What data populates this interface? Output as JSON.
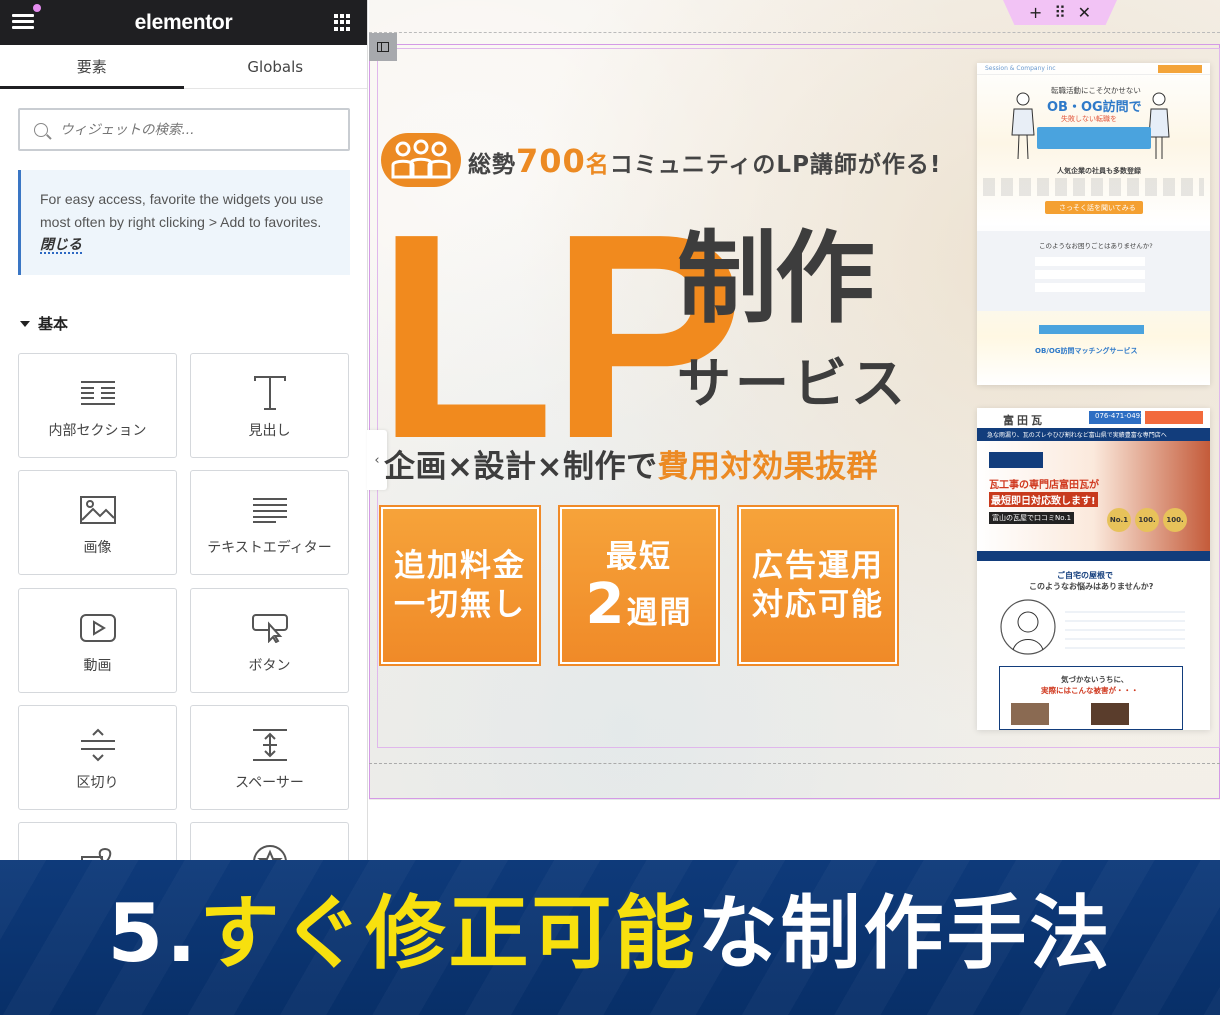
{
  "panel": {
    "logo": "elementor",
    "tabs": [
      "要素",
      "Globals"
    ],
    "search_placeholder": "ウィジェットの検索...",
    "notice_text": "For easy access, favorite the widgets you use most often by right clicking > Add to favorites.",
    "notice_link": "閉じる",
    "category": "基本",
    "widgets": [
      {
        "label": "内部セクション",
        "icon": "inner-section-icon"
      },
      {
        "label": "見出し",
        "icon": "heading-icon"
      },
      {
        "label": "画像",
        "icon": "image-icon"
      },
      {
        "label": "テキストエディター",
        "icon": "text-editor-icon"
      },
      {
        "label": "動画",
        "icon": "video-icon"
      },
      {
        "label": "ボタン",
        "icon": "button-icon"
      },
      {
        "label": "区切り",
        "icon": "divider-icon"
      },
      {
        "label": "スペーサー",
        "icon": "spacer-icon"
      }
    ]
  },
  "canvas": {
    "section_handle": [
      "+",
      "⠿",
      "✕"
    ],
    "tagline_pre": "総勢",
    "tagline_num": "700",
    "tagline_post_accent": "名",
    "tagline_post": "コミュニティのLP講師が作る!",
    "big_letters": "LP",
    "title_main": "制作",
    "title_sub": "サービス",
    "subhead_pre": "企画×設計×制作で",
    "subhead_accent": "費用対効果抜群",
    "boxes": [
      {
        "line1": "追加料金",
        "line2": "一切無し"
      },
      {
        "line1": "最短",
        "big": "2",
        "line2": "週間"
      },
      {
        "line1": "広告運用",
        "line2": "対応可能"
      }
    ],
    "thumb1": {
      "brand": "Session & Company inc",
      "headline1": "転職活動にこそ欠かせない",
      "headline2": "OB・OG訪問で",
      "headline3": "失敗しない転職を",
      "section": "人気企業の社員も多数登録",
      "cta": "さっそく話を聞いてみる",
      "question": "このようなお困りごとはありませんか?",
      "service": "OB/OG訪問マッチングサービス"
    },
    "thumb2": {
      "shop": "富田瓦",
      "phone": "076-471-0492",
      "banner": "急な雨漏り、瓦のズレやひび割れなど富山県で実績豊富な専門店へ",
      "headline1": "瓦工事の専門店富田瓦が",
      "headline2": "最短即日対応致します!",
      "rating": "富山の瓦屋で口コミNo.1",
      "badges": [
        "No.1",
        "100.",
        "100."
      ],
      "question1": "ご自宅の屋根で",
      "question2": "このようなお悩みはありませんか?",
      "warning1": "気づかないうちに、",
      "warning2": "実際にはこんな被害が・・・"
    }
  },
  "bottom": {
    "prefix": "5.",
    "highlight": "すぐ修正可能",
    "rest": "な制作手法"
  },
  "colors": {
    "accent_orange": "#f18a1e",
    "elementor_dark": "#1f1f22",
    "banner_blue": "#0e3a7a",
    "highlight_yellow": "#f7e00e"
  }
}
